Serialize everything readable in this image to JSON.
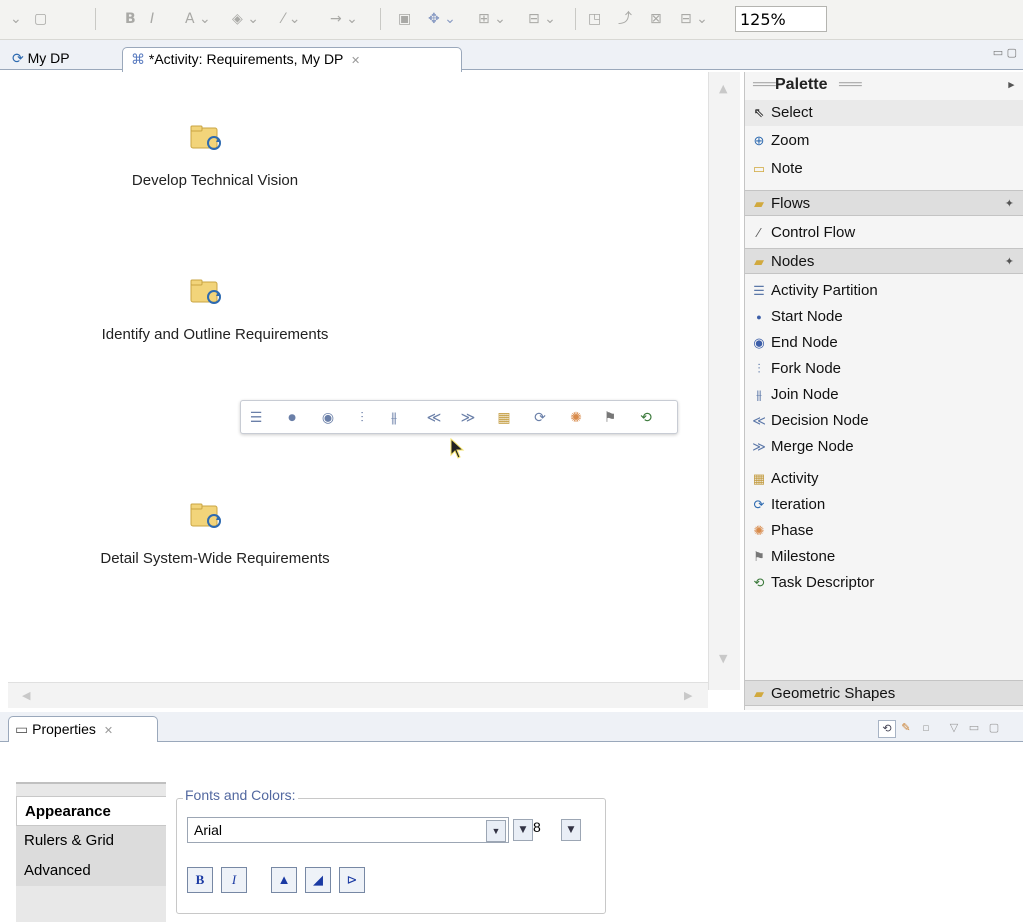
{
  "toolbar": {
    "zoom": "125%"
  },
  "editor": {
    "tabs": [
      {
        "label": "My DP"
      },
      {
        "label": "*Activity: Requirements, My DP"
      }
    ],
    "tasks": [
      {
        "label": "Develop Technical Vision"
      },
      {
        "label": "Identify and Outline Requirements"
      },
      {
        "label": "Detail System-Wide Requirements"
      }
    ]
  },
  "palette": {
    "title": "Palette",
    "tools": [
      {
        "label": "Select",
        "icon": "pointer-icon"
      },
      {
        "label": "Zoom",
        "icon": "zoom-icon"
      },
      {
        "label": "Note",
        "icon": "note-icon"
      }
    ],
    "flows_drawer": "Flows",
    "flows": [
      {
        "label": "Control Flow",
        "icon": "control-flow-icon"
      }
    ],
    "nodes_drawer": "Nodes",
    "nodes": [
      {
        "label": "Activity Partition",
        "icon": "activity-partition-icon"
      },
      {
        "label": "Start Node",
        "icon": "start-node-icon"
      },
      {
        "label": "End Node",
        "icon": "end-node-icon"
      },
      {
        "label": "Fork Node",
        "icon": "fork-node-icon"
      },
      {
        "label": "Join Node",
        "icon": "join-node-icon"
      },
      {
        "label": "Decision Node",
        "icon": "decision-node-icon"
      },
      {
        "label": "Merge Node",
        "icon": "merge-node-icon"
      },
      {
        "label": "Activity",
        "icon": "activity-icon"
      },
      {
        "label": "Iteration",
        "icon": "iteration-icon"
      },
      {
        "label": "Phase",
        "icon": "phase-icon"
      },
      {
        "label": "Milestone",
        "icon": "milestone-icon"
      },
      {
        "label": "Task Descriptor",
        "icon": "task-descriptor-icon"
      }
    ],
    "geometric_drawer": "Geometric Shapes"
  },
  "properties": {
    "tab": "Properties",
    "left_tabs": [
      "Appearance",
      "Rulers & Grid",
      "Advanced"
    ],
    "fonts_group": "Fonts and Colors:",
    "font_name": "Arial",
    "font_size": "8",
    "format_buttons": [
      "B",
      "I"
    ]
  },
  "colors": {
    "tab_background": "#eef1f6",
    "folder_yellow": "#f2d47a",
    "cycle_blue": "#2d6ab0",
    "legend_blue": "#5268a0"
  }
}
